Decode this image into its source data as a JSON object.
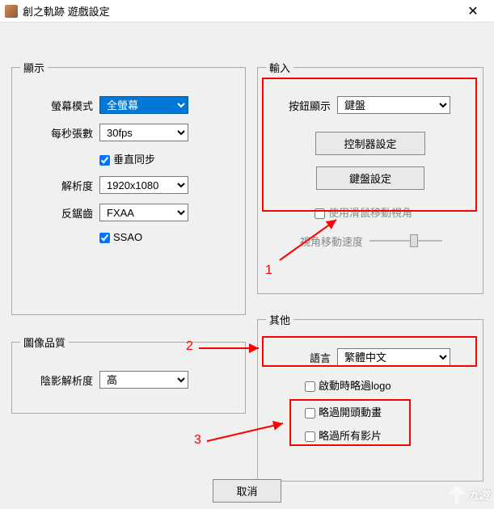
{
  "window": {
    "title": "創之軌跡 遊戲設定"
  },
  "sections": {
    "display": {
      "legend": "顯示",
      "screen_mode": {
        "label": "螢幕模式",
        "value": "全螢幕"
      },
      "fps": {
        "label": "每秒張數",
        "value": "30fps"
      },
      "vsync": {
        "label": "垂直同步",
        "checked": true
      },
      "resolution": {
        "label": "解析度",
        "value": "1920x1080"
      },
      "aa": {
        "label": "反鋸齒",
        "value": "FXAA"
      },
      "ssao": {
        "label": "SSAO",
        "checked": true
      }
    },
    "input": {
      "legend": "輸入",
      "button_display": {
        "label": "按鈕顯示",
        "value": "鍵盤"
      },
      "controller_btn": "控制器設定",
      "keyboard_btn": "鍵盤設定",
      "mouse_view": {
        "label": "使用滑鼠移動視角",
        "checked": false
      },
      "view_speed": {
        "label": "視角移動速度"
      }
    },
    "quality": {
      "legend": "圖像品質",
      "shadow": {
        "label": "陰影解析度",
        "value": "高"
      }
    },
    "other": {
      "legend": "其他",
      "language": {
        "label": "語言",
        "value": "繁體中文"
      },
      "skip_logo": {
        "label": "啟動時略過logo",
        "checked": false
      },
      "skip_opening": {
        "label": "略過開頭動畫",
        "checked": false
      },
      "skip_videos": {
        "label": "略過所有影片",
        "checked": false
      }
    }
  },
  "footer": {
    "cancel": "取消"
  },
  "annotations": {
    "a1": "1",
    "a2": "2",
    "a3": "3"
  },
  "watermark": "九游"
}
